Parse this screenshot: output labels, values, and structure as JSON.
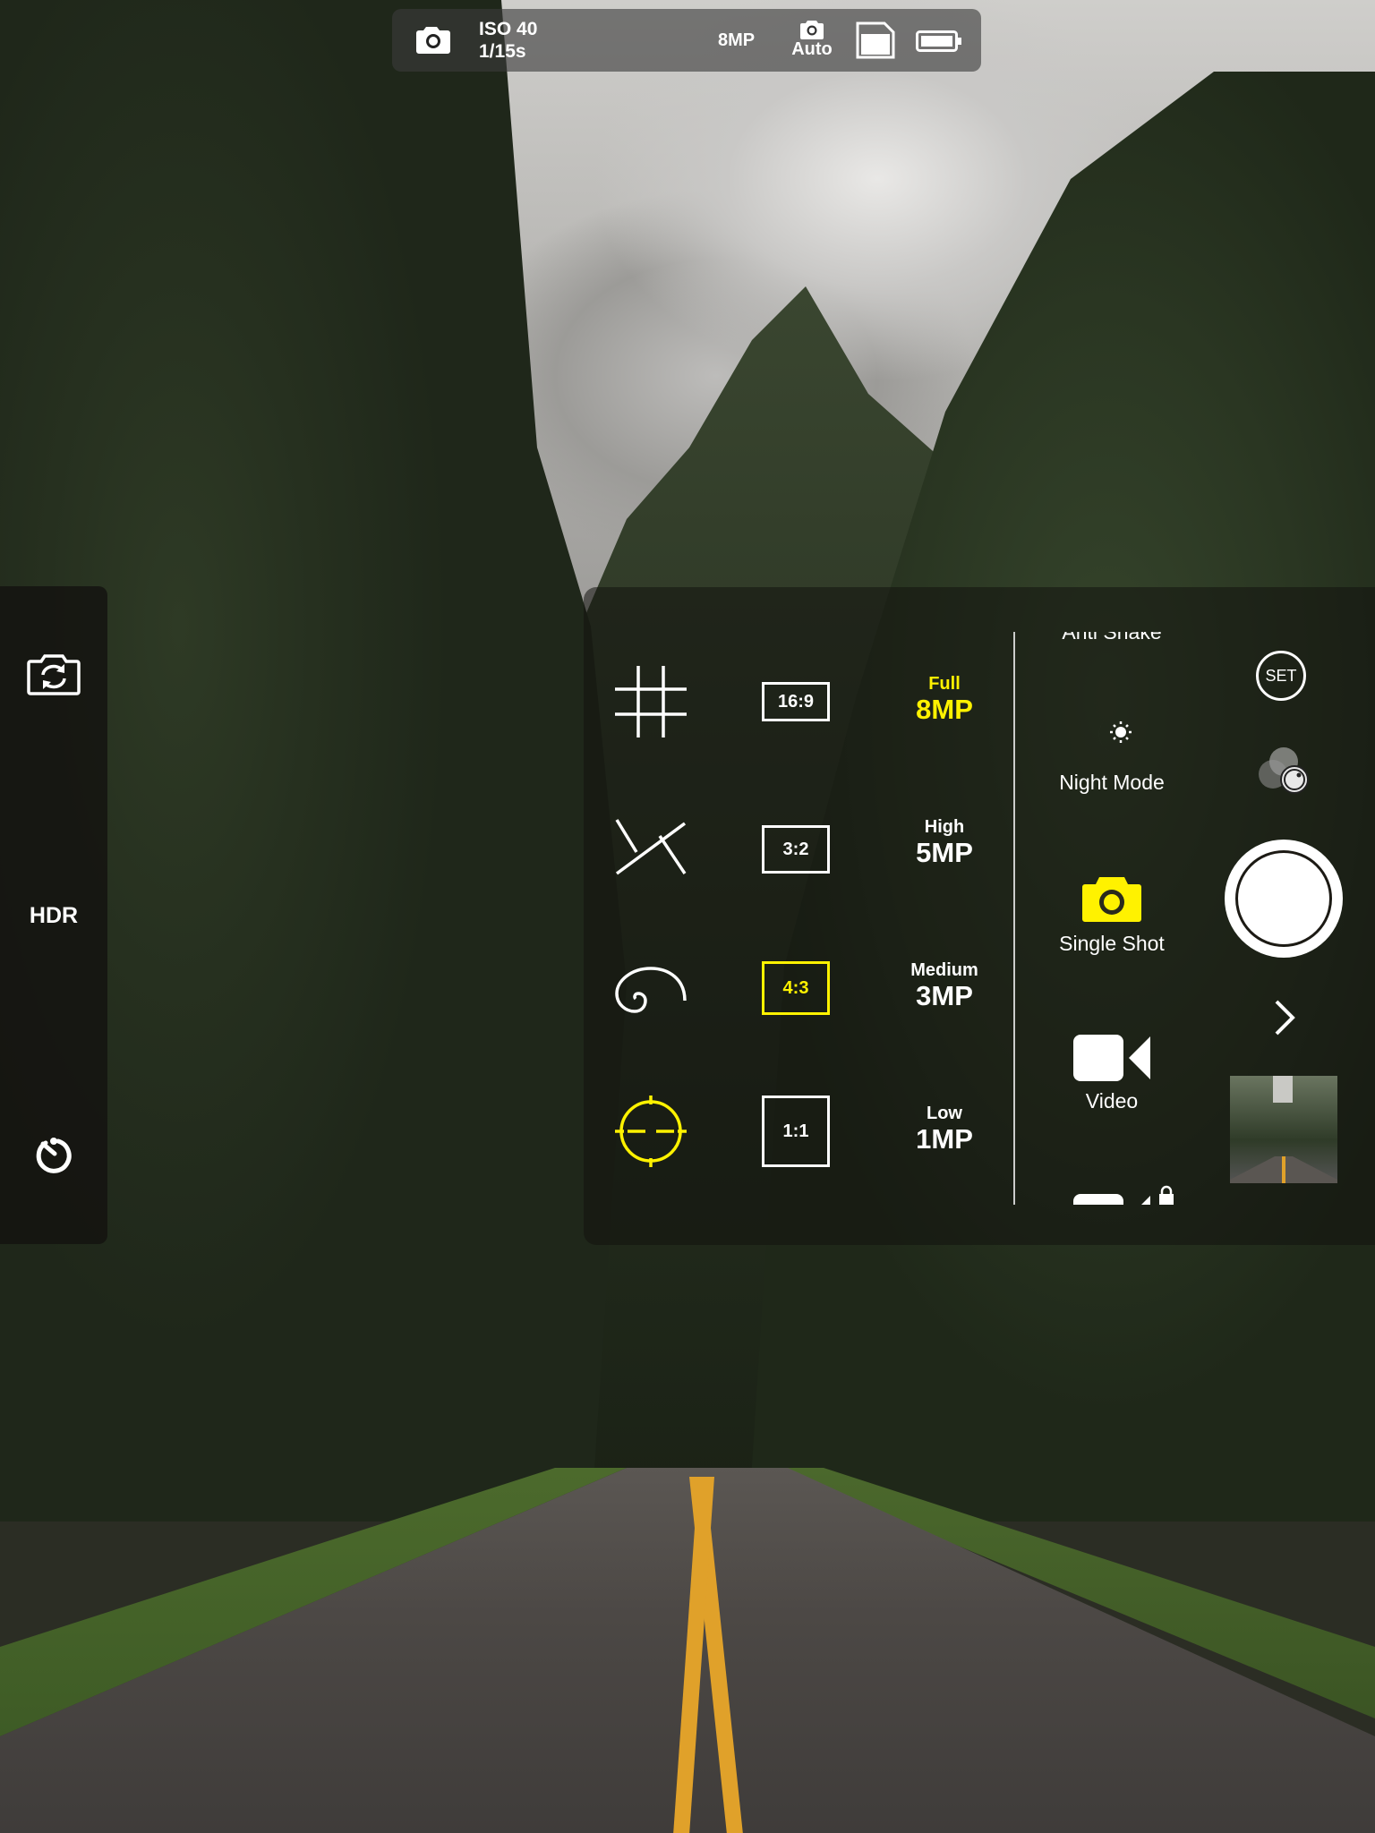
{
  "status_bar": {
    "camera_icon": "camera-icon",
    "iso": "ISO 40",
    "shutter_speed": "1/15s",
    "resolution": "8MP",
    "mode_icon": "camera-small-icon",
    "mode_label": "Auto",
    "storage_icon": "sd-card-icon",
    "battery_icon": "battery-icon"
  },
  "left_panel": {
    "switch_camera_icon": "switch-camera-icon",
    "hdr_label": "HDR",
    "timer_icon": "timer-icon"
  },
  "composition_guides": [
    {
      "name": "grid-icon",
      "selected": false
    },
    {
      "name": "diagonal-icon",
      "selected": false
    },
    {
      "name": "golden-spiral-icon",
      "selected": false
    },
    {
      "name": "crosshair-level-icon",
      "selected": true
    }
  ],
  "aspect_ratios": [
    {
      "label": "16:9",
      "selected": false
    },
    {
      "label": "3:2",
      "selected": false
    },
    {
      "label": "4:3",
      "selected": true
    },
    {
      "label": "1:1",
      "selected": false
    }
  ],
  "resolutions": [
    {
      "quality": "Full",
      "mp": "8MP",
      "selected": true
    },
    {
      "quality": "High",
      "mp": "5MP",
      "selected": false
    },
    {
      "quality": "Medium",
      "mp": "3MP",
      "selected": false
    },
    {
      "quality": "Low",
      "mp": "1MP",
      "selected": false
    }
  ],
  "modes": [
    {
      "label": "Anti Shake",
      "icon": "anti-shake-icon",
      "partial": true
    },
    {
      "label": "Night Mode",
      "icon": "night-mode-icon"
    },
    {
      "label": "Single Shot",
      "icon": "camera-icon",
      "selected": true
    },
    {
      "label": "Video",
      "icon": "video-icon"
    },
    {
      "label": "",
      "icon": "video-icon",
      "partial": true,
      "locked": true
    }
  ],
  "right_controls": {
    "settings_label": "SET",
    "filters_icon": "filters-icon",
    "shutter_icon": "shutter-button",
    "next_icon": "chevron-right-icon",
    "thumbnail": "last-photo-thumbnail"
  },
  "colors": {
    "accent": "#fff200",
    "text": "#ffffff",
    "panel_bg": "#121210"
  }
}
